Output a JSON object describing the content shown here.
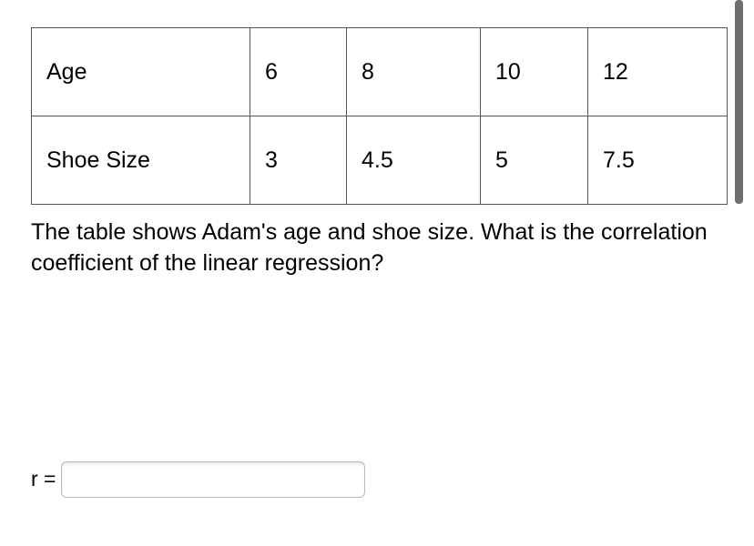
{
  "table": {
    "rows": [
      {
        "label": "Age",
        "v1": "6",
        "v2": "8",
        "v3": "10",
        "v4": "12"
      },
      {
        "label": "Shoe Size",
        "v1": "3",
        "v2": "4.5",
        "v3": "5",
        "v4": "7.5"
      }
    ]
  },
  "question": "The table shows Adam's age and shoe size. What is the correlation coefficient of the linear regression?",
  "answer": {
    "label": "r =",
    "value": ""
  },
  "chart_data": {
    "type": "table",
    "title": "Adam's age and shoe size",
    "columns": [
      "Age",
      "Shoe Size"
    ],
    "rows": [
      {
        "Age": 6,
        "Shoe Size": 3
      },
      {
        "Age": 8,
        "Shoe Size": 4.5
      },
      {
        "Age": 10,
        "Shoe Size": 5
      },
      {
        "Age": 12,
        "Shoe Size": 7.5
      }
    ]
  }
}
